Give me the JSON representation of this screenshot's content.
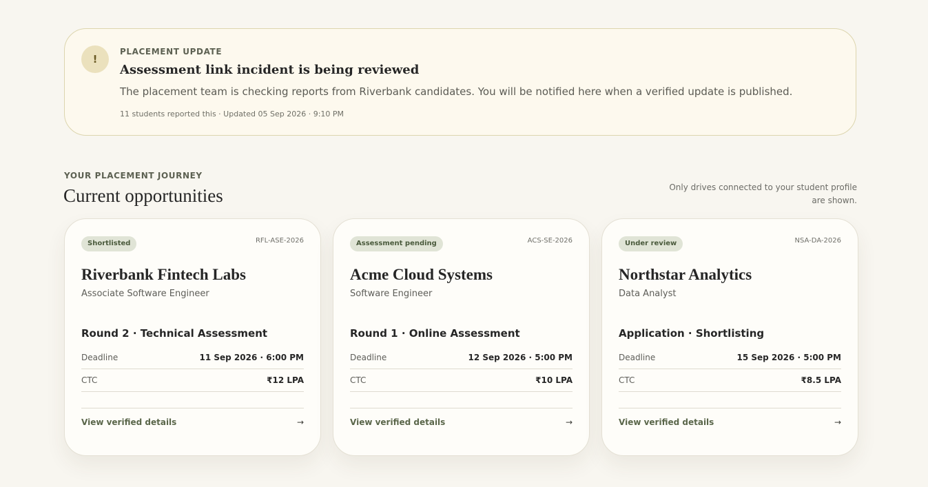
{
  "alert": {
    "icon": "exclamation-icon",
    "icon_glyph": "!",
    "eyebrow": "PLACEMENT UPDATE",
    "title": "Assessment link incident is being reviewed",
    "text": "The placement team is checking reports from Riverbank candidates. You will be notified here when a verified update is published.",
    "meta": "11 students reported this · Updated 05 Sep 2026 · 9:10 PM"
  },
  "section": {
    "eyebrow": "YOUR PLACEMENT JOURNEY",
    "title": "Current opportunities",
    "note": "Only drives connected to your student profile are shown."
  },
  "cards": [
    {
      "badge": "Shortlisted",
      "code": "RFL-ASE-2026",
      "company": "Riverbank Fintech Labs",
      "role": "Associate Software Engineer",
      "stage": "Round 2 · Technical Assessment",
      "deadline_label": "Deadline",
      "deadline": "11 Sep 2026 · 6:00 PM",
      "ctc_label": "CTC",
      "ctc": "₹12 LPA",
      "link": "View verified details",
      "arrow": "→"
    },
    {
      "badge": "Assessment pending",
      "code": "ACS-SE-2026",
      "company": "Acme Cloud Systems",
      "role": "Software Engineer",
      "stage": "Round 1 · Online Assessment",
      "deadline_label": "Deadline",
      "deadline": "12 Sep 2026 · 5:00 PM",
      "ctc_label": "CTC",
      "ctc": "₹10 LPA",
      "link": "View verified details",
      "arrow": "→"
    },
    {
      "badge": "Under review",
      "code": "NSA-DA-2026",
      "company": "Northstar Analytics",
      "role": "Data Analyst",
      "stage": "Application · Shortlisting",
      "deadline_label": "Deadline",
      "deadline": "15 Sep 2026 · 5:00 PM",
      "ctc_label": "CTC",
      "ctc": "₹8.5 LPA",
      "link": "View verified details",
      "arrow": "→"
    }
  ],
  "colors": {
    "background": "#f8f6f0",
    "alert_background": "#fdf9ee",
    "alert_border": "#dcd5ae",
    "badge_background": "#e0e4d6",
    "link": "#5a664a"
  }
}
